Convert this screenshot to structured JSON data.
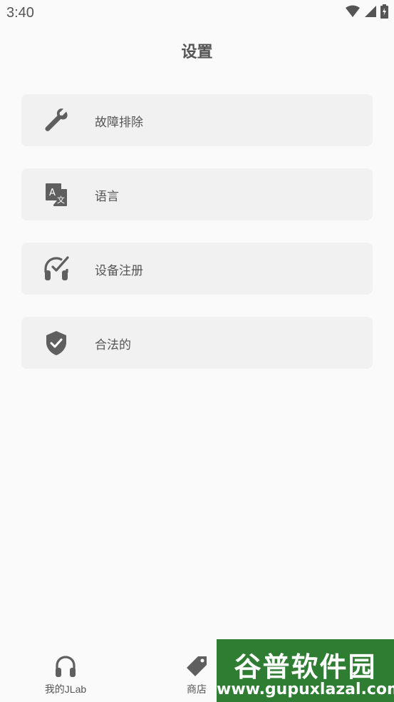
{
  "status_bar": {
    "time": "3:40",
    "icons": [
      "wifi-icon",
      "signal-icon",
      "battery-charging-icon"
    ]
  },
  "header": {
    "title": "设置"
  },
  "menu": {
    "items": [
      {
        "label": "故障排除",
        "icon": "wrench-icon"
      },
      {
        "label": "语言",
        "icon": "translate-icon"
      },
      {
        "label": "设备注册",
        "icon": "headphones-check-icon"
      },
      {
        "label": "合法的",
        "icon": "shield-check-icon"
      }
    ]
  },
  "bottom_nav": {
    "items": [
      {
        "label": "我的JLab",
        "icon": "headphones-icon"
      },
      {
        "label": "商店",
        "icon": "tag-icon"
      }
    ]
  },
  "watermark": {
    "title": "谷普软件园",
    "url": "www.gupuxlazal.com"
  },
  "colors": {
    "background": "#fafafa",
    "card": "#f1f1f1",
    "icon": "#5f5f5f",
    "watermark": "#2e7d32"
  }
}
